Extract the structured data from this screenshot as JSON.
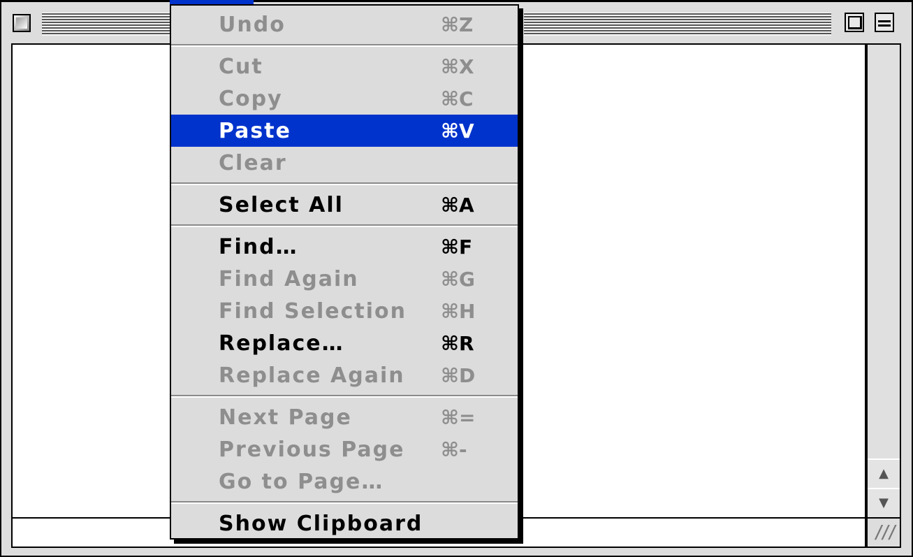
{
  "colors": {
    "menu_highlight": "#0033cc",
    "menu_background": "#dcdcdc",
    "disabled_text": "#8e8e8e",
    "enabled_text": "#000000"
  },
  "window": {
    "close_icon": "close-box-icon",
    "zoom_icon": "zoom-box-icon",
    "collapse_icon": "collapse-box-icon",
    "scroll_up_glyph": "▲",
    "scroll_down_glyph": "▼",
    "grow_glyph": "///"
  },
  "edit_menu": {
    "items": [
      {
        "label": "Undo",
        "shortcut": "⌘Z",
        "enabled": false
      },
      {
        "label": "Cut",
        "shortcut": "⌘X",
        "enabled": false
      },
      {
        "label": "Copy",
        "shortcut": "⌘C",
        "enabled": false
      },
      {
        "label": "Paste",
        "shortcut": "⌘V",
        "enabled": true,
        "selected": true
      },
      {
        "label": "Clear",
        "shortcut": "",
        "enabled": false
      },
      {
        "label": "Select All",
        "shortcut": "⌘A",
        "enabled": true
      },
      {
        "label": "Find…",
        "shortcut": "⌘F",
        "enabled": true
      },
      {
        "label": "Find Again",
        "shortcut": "⌘G",
        "enabled": false
      },
      {
        "label": "Find Selection",
        "shortcut": "⌘H",
        "enabled": false
      },
      {
        "label": "Replace…",
        "shortcut": "⌘R",
        "enabled": true
      },
      {
        "label": "Replace Again",
        "shortcut": "⌘D",
        "enabled": false
      },
      {
        "label": "Next Page",
        "shortcut": "⌘=",
        "enabled": false
      },
      {
        "label": "Previous Page",
        "shortcut": "⌘-",
        "enabled": false
      },
      {
        "label": "Go to Page…",
        "shortcut": "",
        "enabled": false
      },
      {
        "label": "Show Clipboard",
        "shortcut": "",
        "enabled": true
      }
    ]
  }
}
